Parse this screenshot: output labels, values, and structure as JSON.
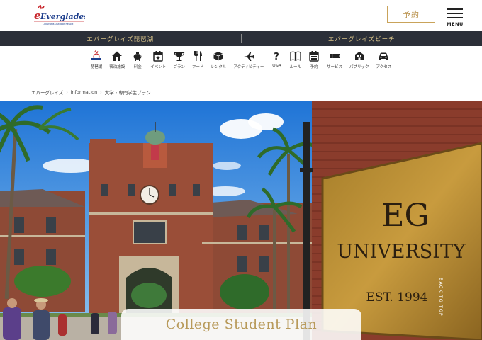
{
  "header": {
    "logo_text": "Everglades",
    "logo_subtitle": "Luxurious Outdoor Resort",
    "reserve_label": "予約",
    "menu_label": "MENU"
  },
  "locations": [
    {
      "label": "エバーグレイズ琵琶湖"
    },
    {
      "label": "エバーグレイズビーチ"
    }
  ],
  "nav": [
    {
      "label": "琵琶湖",
      "icon": "everglades-logo-icon"
    },
    {
      "label": "宿泊施設",
      "icon": "house-icon"
    },
    {
      "label": "料金",
      "icon": "piggy-bank-icon"
    },
    {
      "label": "イベント",
      "icon": "calendar-icon"
    },
    {
      "label": "プラン",
      "icon": "trophy-icon"
    },
    {
      "label": "フード",
      "icon": "fork-knife-icon"
    },
    {
      "label": "レンタル",
      "icon": "box-icon"
    },
    {
      "label": "アクティビティー",
      "icon": "airplane-icon"
    },
    {
      "label": "Q&A",
      "icon": "question-icon"
    },
    {
      "label": "ルール",
      "icon": "book-icon"
    },
    {
      "label": "予約",
      "icon": "calendar-grid-icon"
    },
    {
      "label": "サービス",
      "icon": "ticket-icon"
    },
    {
      "label": "パブリック",
      "icon": "building-icon"
    },
    {
      "label": "アクセス",
      "icon": "car-icon"
    }
  ],
  "breadcrumb": [
    {
      "label": "エバーグレイズ"
    },
    {
      "label": "information"
    },
    {
      "label": "大学・専門学生プラン"
    }
  ],
  "hero": {
    "sign_line1": "EG",
    "sign_line2": "UNIVERSITY",
    "sign_line3": "EST. 1994",
    "back_to_top": "BACK TO TOP",
    "plan_title": "College Student Plan"
  },
  "colors": {
    "accent_gold": "#c9a35a",
    "dark_bar": "#2b2f38",
    "brand_red": "#c8272d",
    "brand_blue": "#1c3d8c"
  }
}
